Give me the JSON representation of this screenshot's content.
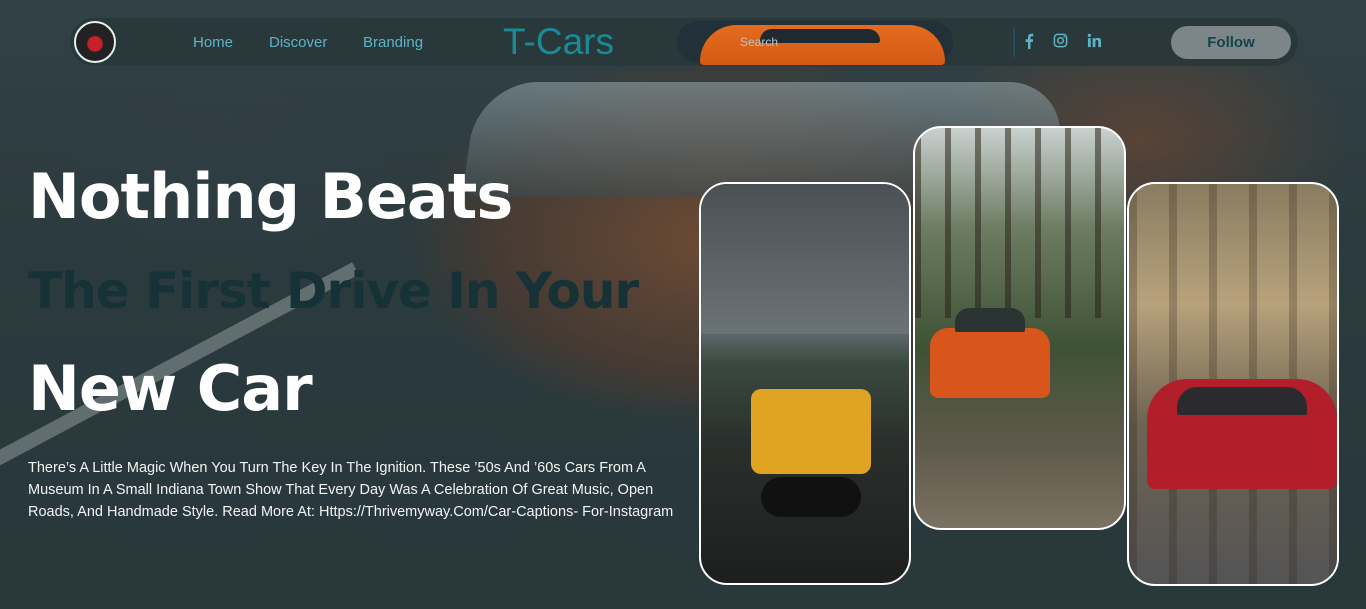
{
  "nav": {
    "links": [
      "Home",
      "Discover",
      "Branding"
    ],
    "brand": "T-Cars",
    "search_placeholder": "Search",
    "social": [
      "f",
      "ig",
      "in"
    ],
    "follow_label": "Follow"
  },
  "hero": {
    "line1": "Nothing Beats",
    "line2": "The First Drive In Your",
    "line3": "New Car",
    "description": "There’s A Little Magic When You Turn The Key In The Ignition. These ’50s And ’60s Cars From A Museum In A Small Indiana Town Show That Every Day Was A Celebration Of Great Music, Open Roads, And Handmade Style. Read More At: Https://Thrivemyway.Com/Car-Captions- For-Instagram"
  },
  "cards": [
    "jeep-photo",
    "mustang-photo",
    "audi-photo"
  ],
  "colors": {
    "accent": "#5fb3c4",
    "brand": "#1a8a96",
    "dark_text": "#163236"
  }
}
